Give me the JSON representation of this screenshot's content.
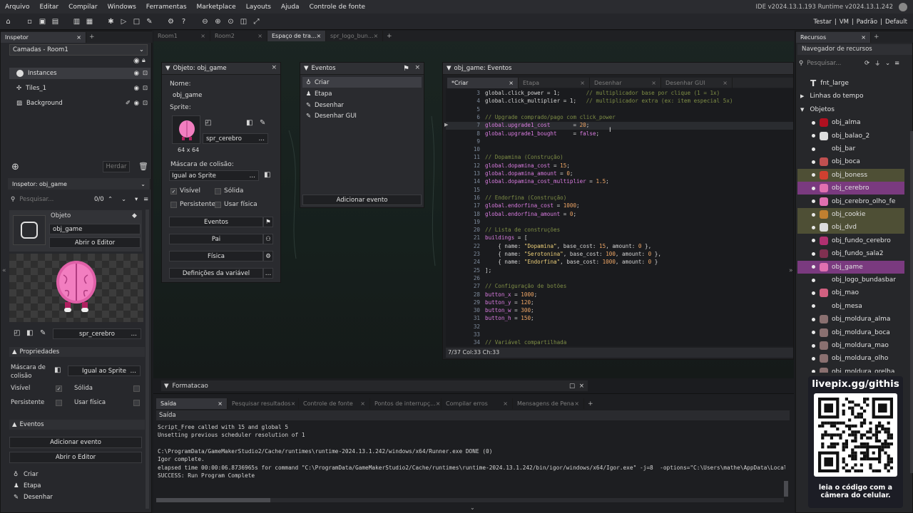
{
  "menu": [
    "Arquivo",
    "Editar",
    "Compilar",
    "Windows",
    "Ferramentas",
    "Marketplace",
    "Layouts",
    "Ajuda",
    "Controle de fonte"
  ],
  "ide_version": "IDE v2024.13.1.193 Runtime v2024.13.1.242",
  "toolbar_right": [
    "Testar",
    "VM",
    "Padrão",
    "Default"
  ],
  "left": {
    "inspector_tab": "Inspetor",
    "layers_dropdown": "Camadas - Room1",
    "layers": [
      "Instances",
      "Tiles_1",
      "Background"
    ],
    "hide_btn": "Herdar",
    "obj_inspector_title": "Inspetor: obj_game",
    "search_placeholder": "Pesquisar...",
    "search_count": "0/0",
    "obj_label": "Objeto",
    "obj_name": "obj_game",
    "open_editor": "Abrir o Editor",
    "sprite_name": "spr_cerebro",
    "props_header": "Propriedades",
    "mask_label": "Máscara de colisão",
    "mask_value": "Igual ao Sprite",
    "visible": "Visível",
    "solid": "Sólida",
    "persistent": "Persistente",
    "physics": "Usar física",
    "events_header": "Eventos",
    "add_event": "Adicionar evento",
    "open_editor2": "Abrir o Editor",
    "events": [
      "Criar",
      "Etapa",
      "Desenhar"
    ]
  },
  "doc_tabs": [
    "Room1",
    "Room2",
    "Espaço de tra...",
    "spr_logo_bun..."
  ],
  "obj_window": {
    "title": "Objeto: obj_game",
    "name_label": "Nome:",
    "name": "obj_game",
    "sprite_label": "Sprite:",
    "sprite_name": "spr_cerebro",
    "sprite_size": "64 x 64",
    "mask_label": "Máscara de colisão:",
    "mask_value": "Igual ao Sprite",
    "visible": "Visível",
    "solid": "Sólida",
    "persistent": "Persistente",
    "physics": "Usar física",
    "buttons": [
      "Eventos",
      "Pai",
      "Física",
      "Definições da variável"
    ]
  },
  "events_window": {
    "title": "Eventos",
    "items": [
      "Criar",
      "Etapa",
      "Desenhar",
      "Desenhar GUI"
    ],
    "add": "Adicionar evento"
  },
  "code_window": {
    "title": "obj_game: Eventos",
    "tabs": [
      "*Criar",
      "Etapa",
      "Desenhar",
      "Desenhar GUI"
    ],
    "status": "7/37 Col:33 Ch:33",
    "lines": [
      {
        "n": "3",
        "t": [
          [
            "pl",
            "global.click_power = 1;        "
          ],
          [
            "cm",
            "// multiplicador base por clique (1 = 1x)"
          ]
        ]
      },
      {
        "n": "4",
        "t": [
          [
            "pl",
            "global.click_multiplier = 1;   "
          ],
          [
            "cm",
            "// multiplicador extra (ex: item especial 5x)"
          ]
        ]
      },
      {
        "n": "5",
        "t": []
      },
      {
        "n": "6",
        "t": [
          [
            "cm",
            "// Upgrade comprado/pago com click_power"
          ]
        ]
      },
      {
        "n": "7",
        "t": [
          [
            "kw",
            "global.upgrade1_cost"
          ],
          [
            "pl",
            "       = "
          ],
          [
            "nm",
            "20"
          ],
          [
            "pl",
            ";"
          ]
        ]
      },
      {
        "n": "8",
        "t": [
          [
            "kw",
            "global.upgrade1_bought"
          ],
          [
            "pl",
            "     = "
          ],
          [
            "kw",
            "false"
          ],
          [
            "pl",
            ";"
          ]
        ]
      },
      {
        "n": "9",
        "t": []
      },
      {
        "n": "10",
        "t": []
      },
      {
        "n": "11",
        "t": [
          [
            "cm",
            "// Dopamina (Construção)"
          ]
        ]
      },
      {
        "n": "12",
        "t": [
          [
            "kw",
            "global.dopamina_cost"
          ],
          [
            "pl",
            " = "
          ],
          [
            "nm",
            "15"
          ],
          [
            "pl",
            ";"
          ]
        ]
      },
      {
        "n": "13",
        "t": [
          [
            "kw",
            "global.dopamina_amount"
          ],
          [
            "pl",
            " = "
          ],
          [
            "nm",
            "0"
          ],
          [
            "pl",
            ";"
          ]
        ]
      },
      {
        "n": "14",
        "t": [
          [
            "kw",
            "global.dopamina_cost_multiplier"
          ],
          [
            "pl",
            " = "
          ],
          [
            "nm",
            "1.5"
          ],
          [
            "pl",
            ";"
          ]
        ]
      },
      {
        "n": "15",
        "t": []
      },
      {
        "n": "16",
        "t": [
          [
            "cm",
            "// Endorfina (Construção)"
          ]
        ]
      },
      {
        "n": "17",
        "t": [
          [
            "kw",
            "global.endorfina_cost"
          ],
          [
            "pl",
            " = "
          ],
          [
            "nm",
            "1000"
          ],
          [
            "pl",
            ";"
          ]
        ]
      },
      {
        "n": "18",
        "t": [
          [
            "kw",
            "global.endorfina_amount"
          ],
          [
            "pl",
            " = "
          ],
          [
            "nm",
            "0"
          ],
          [
            "pl",
            ";"
          ]
        ]
      },
      {
        "n": "19",
        "t": []
      },
      {
        "n": "20",
        "t": [
          [
            "cm",
            "// Lista de construções"
          ]
        ]
      },
      {
        "n": "21",
        "t": [
          [
            "kw",
            "buildings"
          ],
          [
            "pl",
            " = ["
          ]
        ]
      },
      {
        "n": "22",
        "t": [
          [
            "pl",
            "    { name: "
          ],
          [
            "st",
            "\"Dopamina\""
          ],
          [
            "pl",
            ", base_cost: "
          ],
          [
            "nm",
            "15"
          ],
          [
            "pl",
            ", amount: "
          ],
          [
            "nm",
            "0"
          ],
          [
            "pl",
            " },"
          ]
        ]
      },
      {
        "n": "23",
        "t": [
          [
            "pl",
            "    { name: "
          ],
          [
            "st",
            "\"Serotonina\""
          ],
          [
            "pl",
            ", base_cost: "
          ],
          [
            "nm",
            "100"
          ],
          [
            "pl",
            ", amount: "
          ],
          [
            "nm",
            "0"
          ],
          [
            "pl",
            " },"
          ]
        ]
      },
      {
        "n": "24",
        "t": [
          [
            "pl",
            "    { name: "
          ],
          [
            "st",
            "\"Endorfina\""
          ],
          [
            "pl",
            ", base_cost: "
          ],
          [
            "nm",
            "1000"
          ],
          [
            "pl",
            ", amount: "
          ],
          [
            "nm",
            "0"
          ],
          [
            "pl",
            " }"
          ]
        ]
      },
      {
        "n": "25",
        "t": [
          [
            "pl",
            "];"
          ]
        ]
      },
      {
        "n": "26",
        "t": []
      },
      {
        "n": "27",
        "t": [
          [
            "cm",
            "// Configuração de botões"
          ]
        ]
      },
      {
        "n": "28",
        "t": [
          [
            "kw",
            "button_x"
          ],
          [
            "pl",
            " = "
          ],
          [
            "nm",
            "1000"
          ],
          [
            "pl",
            ";"
          ]
        ]
      },
      {
        "n": "29",
        "t": [
          [
            "kw",
            "button_y"
          ],
          [
            "pl",
            " = "
          ],
          [
            "nm",
            "120"
          ],
          [
            "pl",
            ";"
          ]
        ]
      },
      {
        "n": "30",
        "t": [
          [
            "kw",
            "button_w"
          ],
          [
            "pl",
            " = "
          ],
          [
            "nm",
            "300"
          ],
          [
            "pl",
            ";"
          ]
        ]
      },
      {
        "n": "31",
        "t": [
          [
            "kw",
            "button_h"
          ],
          [
            "pl",
            " = "
          ],
          [
            "nm",
            "150"
          ],
          [
            "pl",
            ";"
          ]
        ]
      },
      {
        "n": "32",
        "t": []
      },
      {
        "n": "33",
        "t": []
      },
      {
        "n": "34",
        "t": [
          [
            "cm",
            "// Variável compartilhada"
          ]
        ]
      }
    ]
  },
  "output": {
    "header": "Formatacao",
    "tabs": [
      "Saída",
      "Pesquisar resultados",
      "Controle de fonte",
      "Pontos de interrupç...",
      "Compilar erros",
      "Mensagens de Pena"
    ],
    "subheader": "Saída",
    "lines": [
      "Script_Free called with 15 and global 5",
      "Unsetting previous scheduler resolution of 1",
      "",
      "C:\\ProgramData/GameMakerStudio2/Cache/runtimes\\runtime-2024.13.1.242/windows/x64/Runner.exe DONE (0)",
      "Igor complete.",
      "elapsed time 00:00:06.8736965s for command \"C:\\ProgramData/GameMakerStudio2/Cache/runtimes\\runtime-2024.13.1.242/bin/igor/windows/x64/Igor.exe\" -j=8  -options=\"C:\\Users\\mathe\\AppData\\Local",
      "SUCCESS: Run Program Complete"
    ]
  },
  "resources": {
    "tab": "Recursos",
    "browser": "Navegador de recursos",
    "search_placeholder": "Pesquisar...",
    "items": [
      {
        "label": "fnt_large",
        "kind": "font"
      },
      {
        "label": "Linhas do tempo",
        "kind": "folder"
      },
      {
        "label": "Objetos",
        "kind": "folder-open"
      },
      {
        "label": "obj_alma",
        "kind": "obj",
        "color": "#b01020"
      },
      {
        "label": "obj_balao_2",
        "kind": "obj",
        "color": "#dddddd"
      },
      {
        "label": "obj_bar",
        "kind": "obj",
        "color": ""
      },
      {
        "label": "obj_boca",
        "kind": "obj",
        "color": "#c05050"
      },
      {
        "label": "obj_boness",
        "kind": "obj",
        "color": "#d04030",
        "hl": "#4e4f35"
      },
      {
        "label": "obj_cerebro",
        "kind": "obj",
        "color": "#e070b0",
        "hl": "#7a3a7f"
      },
      {
        "label": "obj_cerebro_olho_fe",
        "kind": "obj",
        "color": "#e070b0"
      },
      {
        "label": "obj_cookie",
        "kind": "obj",
        "color": "#c08030",
        "hl": "#4e4f35"
      },
      {
        "label": "obj_dvd",
        "kind": "obj",
        "color": "#dddddd",
        "hl": "#4e4f35"
      },
      {
        "label": "obj_fundo_cerebro",
        "kind": "obj",
        "color": "#b03070"
      },
      {
        "label": "obj_fundo_sala2",
        "kind": "obj",
        "color": "#803050"
      },
      {
        "label": "obj_game",
        "kind": "obj",
        "color": "#e070b0",
        "hl": "#7a3a7f"
      },
      {
        "label": "obj_logo_bundasbar",
        "kind": "obj",
        "color": ""
      },
      {
        "label": "obj_mao",
        "kind": "obj",
        "color": "#d06080"
      },
      {
        "label": "obj_mesa",
        "kind": "obj",
        "color": ""
      },
      {
        "label": "obj_moldura_alma",
        "kind": "obj",
        "color": "#8a7070"
      },
      {
        "label": "obj_moldura_boca",
        "kind": "obj",
        "color": "#8a7070"
      },
      {
        "label": "obj_moldura_mao",
        "kind": "obj",
        "color": "#8a7070"
      },
      {
        "label": "obj_moldura_olho",
        "kind": "obj",
        "color": "#8a7070"
      },
      {
        "label": "obj_moldura_orelha",
        "kind": "obj",
        "color": "#8a7070"
      }
    ]
  },
  "overlay": {
    "url": "livepix.gg/githis",
    "caption": "leia o código com a câmera do celular."
  }
}
